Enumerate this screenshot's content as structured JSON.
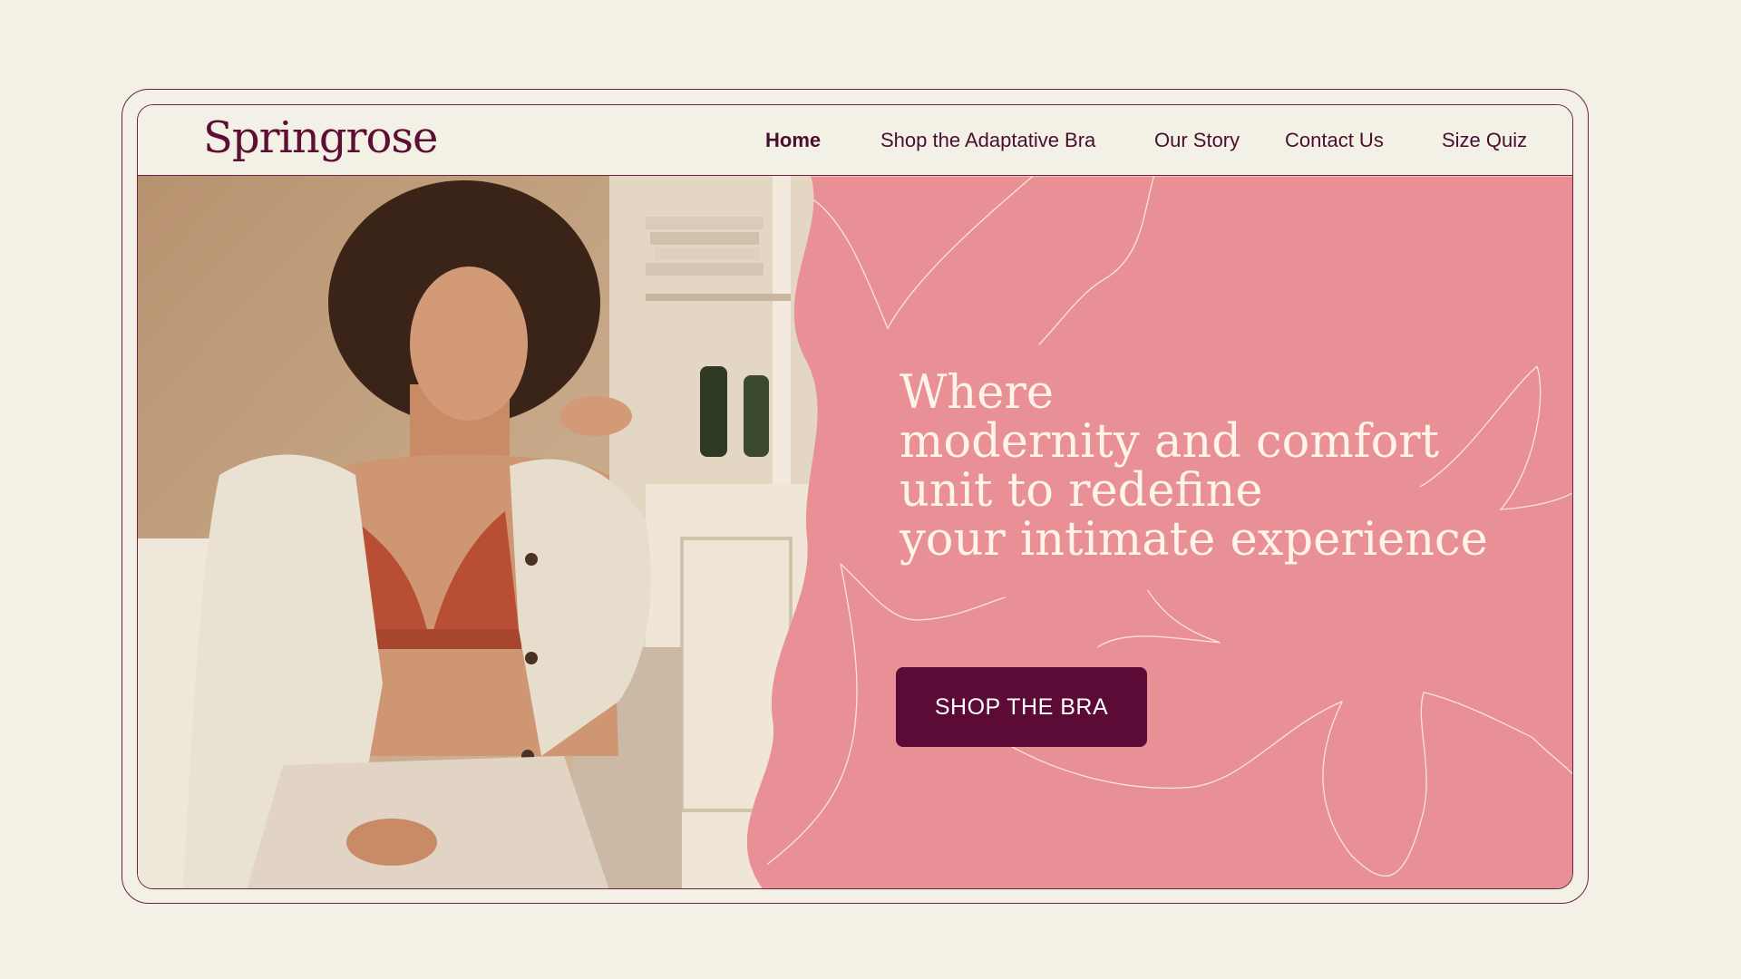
{
  "brand": {
    "logo_text": "Springrose"
  },
  "nav": {
    "items": [
      {
        "label": "Home",
        "active": true
      },
      {
        "label": "Shop the Adaptative Bra",
        "active": false
      },
      {
        "label": "Our Story",
        "active": false
      },
      {
        "label": "Contact Us",
        "active": false
      },
      {
        "label": "Size Quiz",
        "active": false
      }
    ]
  },
  "hero": {
    "headline_lines": [
      "Where",
      "modernity and comfort",
      "unit to redefine",
      "your intimate experience"
    ],
    "cta_label": "SHOP THE BRA",
    "photo_description_icon": "woman-portrait-image"
  },
  "colors": {
    "page_bg": "#F3F0E6",
    "frame": "#6B2340",
    "brand_plum": "#5C0B36",
    "hero_pink": "#E99096",
    "headline_cream": "#FFF3EA"
  }
}
